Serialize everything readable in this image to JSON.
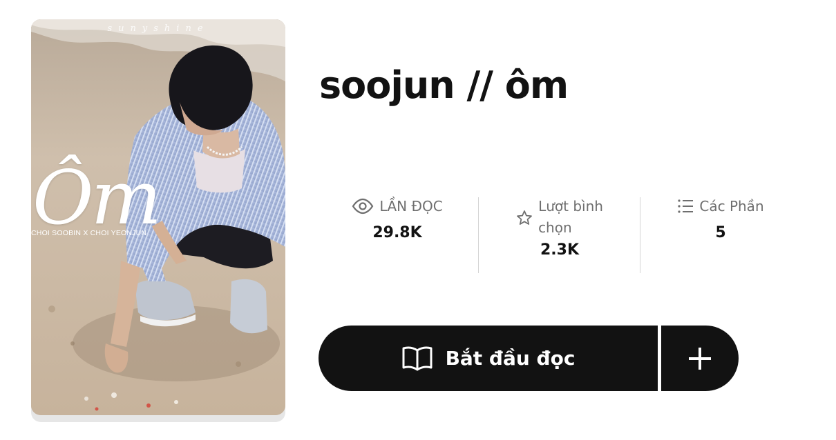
{
  "cover": {
    "brand": "sunyshine",
    "title": "Ôm",
    "subtitle": "CHOI SOOBIN X CHOI YEONJUN"
  },
  "story": {
    "title": "soojun // ôm"
  },
  "stats": {
    "reads": {
      "label": "LẦN ĐỌC",
      "value": "29.8K",
      "icon": "eye-icon"
    },
    "votes": {
      "label_line1": "Lượt bình",
      "label_line2": "chọn",
      "value": "2.3K",
      "icon": "star-icon"
    },
    "parts": {
      "label": "Các Phần",
      "value": "5",
      "icon": "list-icon"
    }
  },
  "actions": {
    "start_label": "Bắt đầu đọc",
    "start_icon": "open-book-icon",
    "add_icon": "plus-icon"
  },
  "colors": {
    "primary": "#121212",
    "muted_text": "#6f6f6f",
    "divider": "#d4d4d4"
  }
}
